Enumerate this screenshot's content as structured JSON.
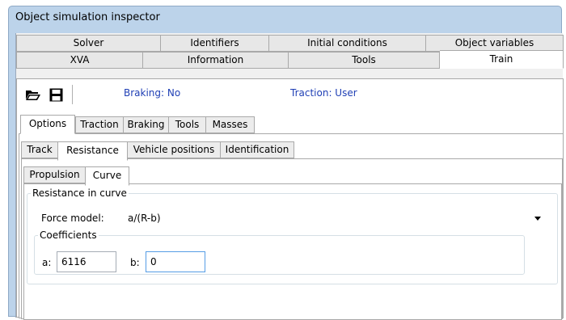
{
  "window": {
    "title": "Object simulation inspector"
  },
  "tabs_row1": [
    {
      "label": "Solver"
    },
    {
      "label": "Identifiers"
    },
    {
      "label": "Initial conditions"
    },
    {
      "label": "Object variables"
    }
  ],
  "tabs_row2": [
    {
      "label": "XVA"
    },
    {
      "label": "Information"
    },
    {
      "label": "Tools"
    },
    {
      "label": "Train"
    }
  ],
  "toolbar": {
    "open_icon": "folder-open-icon",
    "save_icon": "save-icon",
    "braking": "Braking: No",
    "traction": "Traction: User"
  },
  "subtabs_l1": [
    {
      "label": "Options"
    },
    {
      "label": "Traction"
    },
    {
      "label": "Braking"
    },
    {
      "label": "Tools"
    },
    {
      "label": "Masses"
    }
  ],
  "subtabs_l2": [
    {
      "label": "Track"
    },
    {
      "label": "Resistance"
    },
    {
      "label": "Vehicle positions"
    },
    {
      "label": "Identification"
    }
  ],
  "subtabs_l3": [
    {
      "label": "Propulsion"
    },
    {
      "label": "Curve"
    }
  ],
  "resistance": {
    "group_title": "Resistance in curve",
    "force_model_label": "Force model:",
    "force_model_value": "a/(R-b)",
    "coefficients_title": "Coefficients",
    "a_label": "a:",
    "a_value": "6116",
    "b_label": "b:",
    "b_value": "0"
  },
  "colors": {
    "status_text": "#1f3fb5",
    "window_frame": "#bcd3ea",
    "focus_border": "#569de5"
  }
}
